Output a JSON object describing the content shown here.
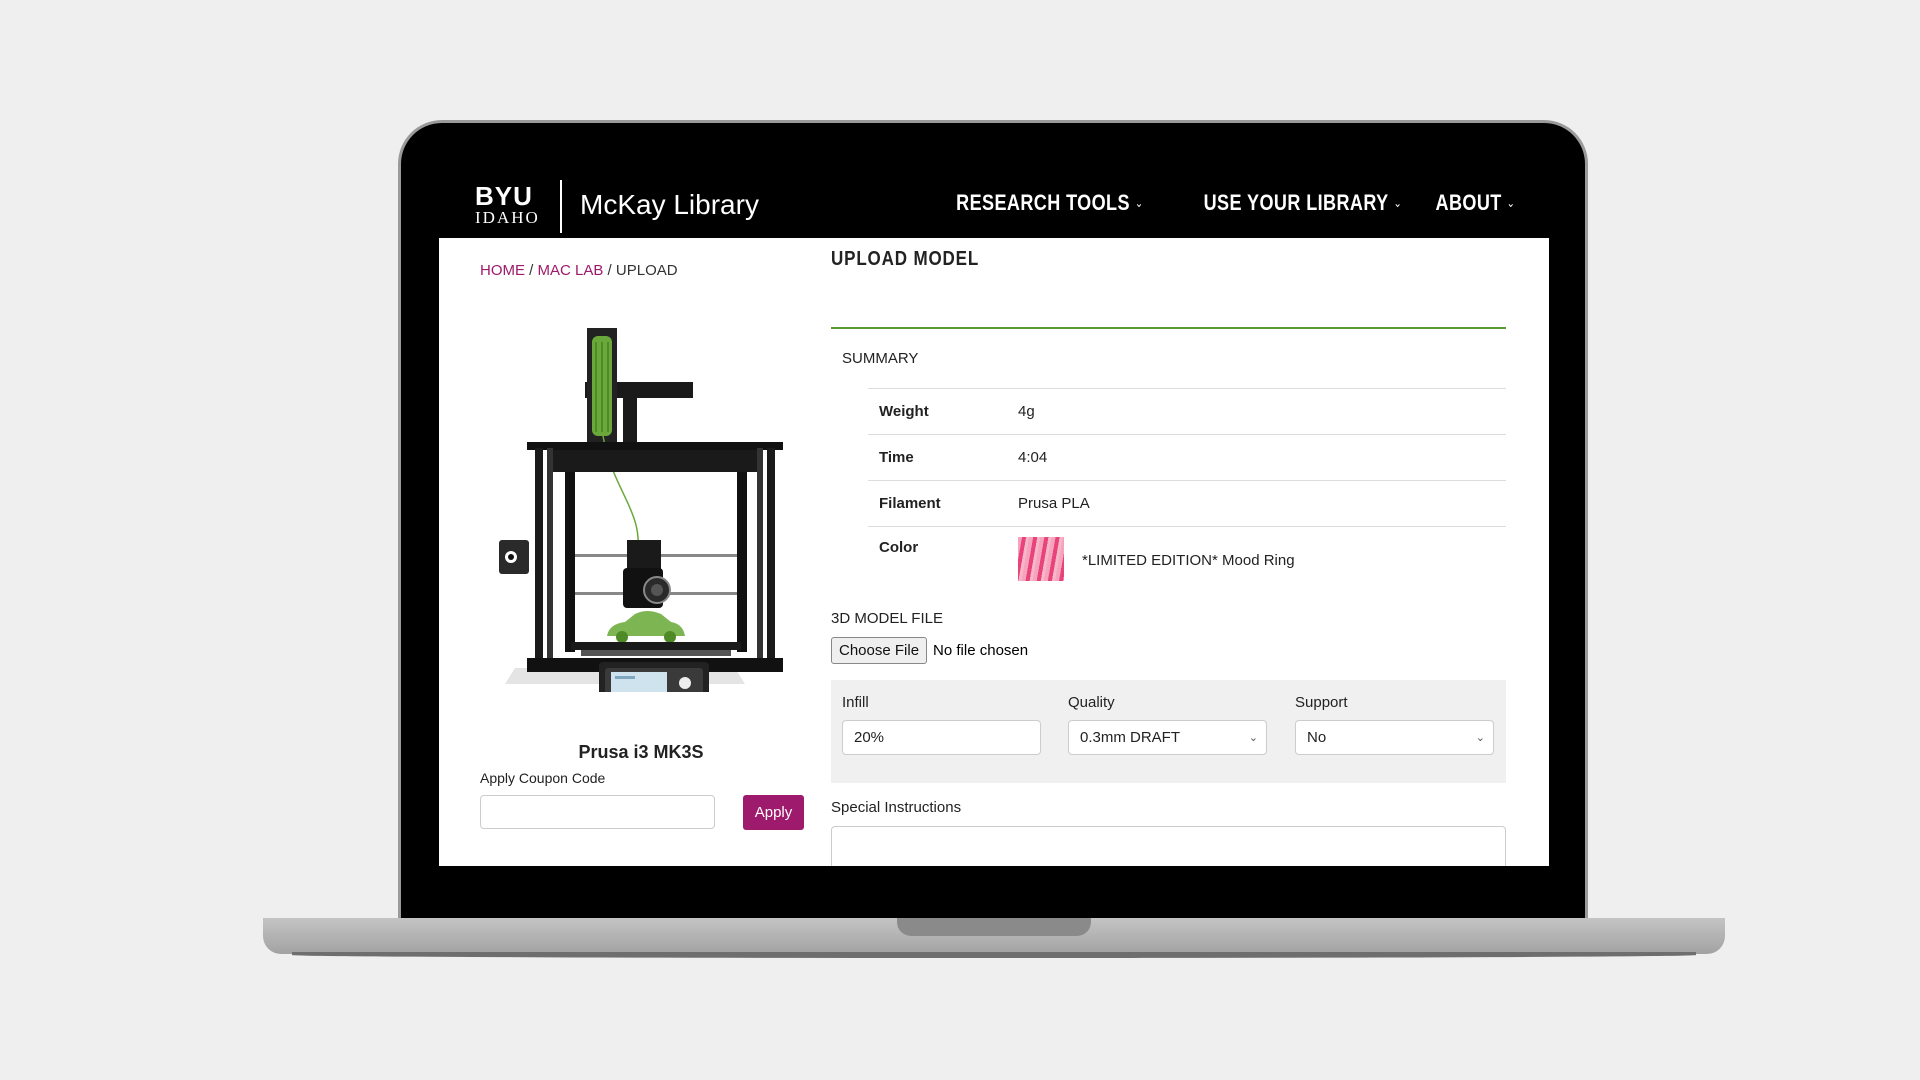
{
  "header": {
    "logo_byu": "BYU",
    "logo_idaho": "IDAHO",
    "site_title": "McKay Library",
    "nav": [
      {
        "label": "RESEARCH TOOLS"
      },
      {
        "label": "USE YOUR LIBRARY"
      },
      {
        "label": "ABOUT"
      }
    ]
  },
  "breadcrumb": {
    "home": "HOME",
    "mac_lab": "MAC LAB",
    "current": "UPLOAD",
    "separator": "/"
  },
  "printer": {
    "name": "Prusa i3 MK3S",
    "filament_color": "#6aa83b",
    "model_color": "#7cb552"
  },
  "coupon": {
    "label": "Apply Coupon Code",
    "value": "",
    "apply_label": "Apply",
    "accent": "#9e1a6c"
  },
  "upload": {
    "title": "UPLOAD MODEL",
    "summary_heading": "SUMMARY",
    "summary": [
      {
        "key": "Weight",
        "value": "4g"
      },
      {
        "key": "Time",
        "value": "4:04"
      },
      {
        "key": "Filament",
        "value": "Prusa PLA"
      },
      {
        "key": "Color",
        "value": "*LIMITED EDITION* Mood Ring"
      }
    ],
    "model_file_label": "3D MODEL FILE",
    "choose_file_label": "Choose File",
    "no_file_text": "No file chosen",
    "options": {
      "infill_label": "Infill",
      "infill_value": "20%",
      "quality_label": "Quality",
      "quality_value": "0.3mm DRAFT",
      "support_label": "Support",
      "support_value": "No"
    },
    "special_instructions_label": "Special Instructions",
    "special_instructions_value": ""
  }
}
